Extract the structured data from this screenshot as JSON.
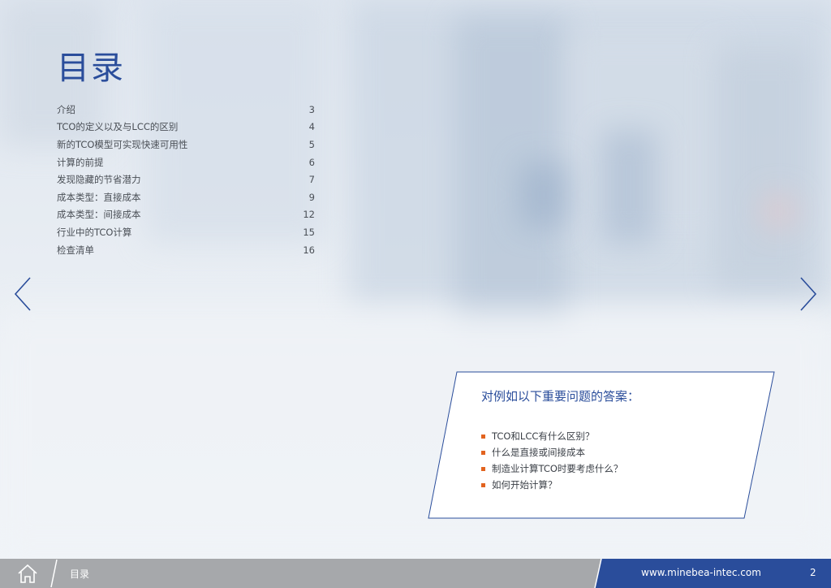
{
  "toc": {
    "title": "目录",
    "items": [
      {
        "label": "介绍",
        "page": "3"
      },
      {
        "label": "TCO的定义以及与LCC的区别",
        "page": "4"
      },
      {
        "label": "新的TCO模型可实现快速可用性",
        "page": "5"
      },
      {
        "label": "计算的前提",
        "page": "6"
      },
      {
        "label": "发现隐藏的节省潜力",
        "page": "7"
      },
      {
        "label": "成本类型：直接成本",
        "page": "9"
      },
      {
        "label": "成本类型：间接成本",
        "page": "12"
      },
      {
        "label": "行业中的TCO计算",
        "page": "15"
      },
      {
        "label": "检查清单",
        "page": "16"
      }
    ]
  },
  "questions": {
    "title": "对例如以下重要问题的答案：",
    "items": [
      "TCO和LCC有什么区别？",
      "什么是直接或间接成本",
      "制造业计算TCO时要考虑什么？",
      "如何开始计算？"
    ]
  },
  "nav": {
    "prev_icon": "chevron-left-icon",
    "next_icon": "chevron-right-icon"
  },
  "footer": {
    "home_icon": "home-icon",
    "section": "目录",
    "url": "www.minebea-intec.com",
    "page": "2"
  },
  "colors": {
    "brand_blue": "#2a4d9b",
    "accent_orange": "#e2631f",
    "footer_gray": "#a6a8ab",
    "text_gray": "#4a4f56"
  }
}
